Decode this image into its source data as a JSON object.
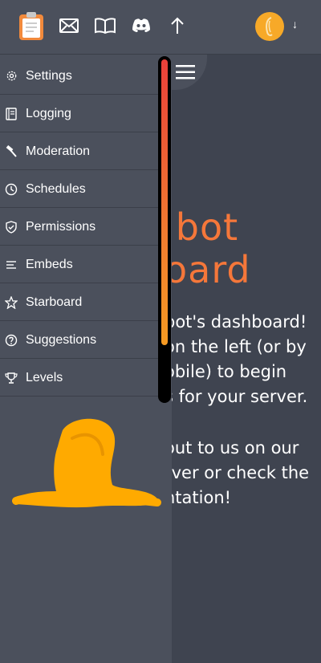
{
  "topbar": {
    "icons": [
      "clipboard-logo-icon",
      "mail-icon",
      "book-icon",
      "discord-icon",
      "arrow-up-icon"
    ],
    "avatar_icon": "user-avatar",
    "dropdown_glyph": "↓"
  },
  "sidebar": {
    "items": [
      {
        "label": "Settings",
        "icon": "gear-icon"
      },
      {
        "label": "Logging",
        "icon": "log-icon"
      },
      {
        "label": "Moderation",
        "icon": "hammer-icon"
      },
      {
        "label": "Schedules",
        "icon": "clock-icon"
      },
      {
        "label": "Permissions",
        "icon": "shield-icon"
      },
      {
        "label": "Embeds",
        "icon": "lines-icon"
      },
      {
        "label": "Starboard",
        "icon": "star-icon"
      },
      {
        "label": "Suggestions",
        "icon": "question-icon"
      },
      {
        "label": "Levels",
        "icon": "trophy-icon"
      }
    ]
  },
  "main": {
    "title_lines": [
      "ibot",
      "oard"
    ],
    "paragraph1": [
      "bot's dashboard!",
      "on the left (or by",
      "obile) to begin",
      "s for your server."
    ],
    "paragraph2": [
      "out to us on our",
      "rver or check the",
      "ntation!"
    ]
  },
  "colors": {
    "accent": "#f5773a",
    "sidebar_bg": "#4b505c",
    "main_bg": "#3f4450",
    "avatar": "#f7a928",
    "scribble": "#ffaa00"
  }
}
